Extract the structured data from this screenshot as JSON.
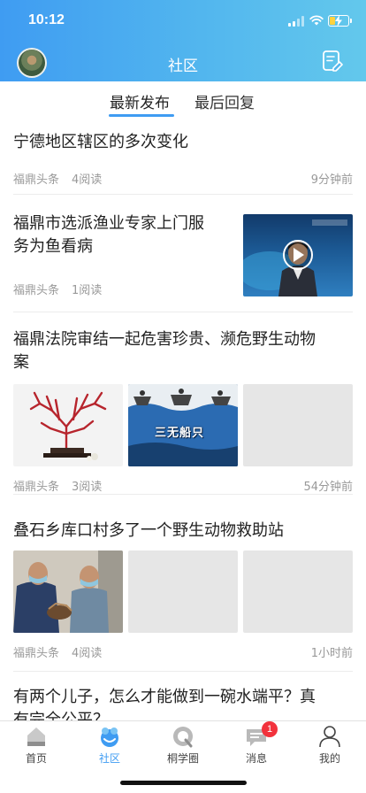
{
  "status_bar": {
    "time": "10:12"
  },
  "header": {
    "title": "社区"
  },
  "tabs": [
    {
      "label": "最新发布",
      "active": true
    },
    {
      "label": "最后回复",
      "active": false
    }
  ],
  "feed": [
    {
      "title": "宁德地区辖区的多次变化",
      "source": "福鼎头条",
      "reads": "4阅读",
      "time": "9分钟前",
      "images": 0
    },
    {
      "title": "福鼎市选派渔业专家上门服务为鱼看病",
      "title_lines": [
        "福鼎市选派渔业专家上门服",
        "务为鱼看病"
      ],
      "source": "福鼎头条",
      "reads": "1阅读",
      "time": "",
      "images": 1,
      "video": true
    },
    {
      "title": "福鼎法院审结一起危害珍贵、濒危野生动物案",
      "title_lines": [
        "福鼎法院审结一起危害珍贵、濒危野生动物",
        "案"
      ],
      "source": "福鼎头条",
      "reads": "3阅读",
      "time": "54分钟前",
      "images": 3,
      "image_caption": "三无船只"
    },
    {
      "title": "叠石乡库口村多了一个野生动物救助站",
      "source": "福鼎头条",
      "reads": "4阅读",
      "time": "1小时前",
      "images": 3
    },
    {
      "title": "有两个儿子，怎么才能做到一碗水端平？真有完全公平？",
      "title_lines": [
        "有两个儿子，怎么才能做到一碗水端平？真",
        "有完全公平？"
      ]
    }
  ],
  "tabbar": [
    {
      "label": "首页",
      "icon": "home-icon",
      "active": false
    },
    {
      "label": "社区",
      "icon": "community-icon",
      "active": true
    },
    {
      "label": "桐学圈",
      "icon": "circle-icon",
      "active": false
    },
    {
      "label": "消息",
      "icon": "message-icon",
      "active": false,
      "badge": "1"
    },
    {
      "label": "我的",
      "icon": "profile-icon",
      "active": false
    }
  ],
  "colors": {
    "accent": "#3f9cf2",
    "badge": "#f2323c",
    "meta": "#999999"
  }
}
